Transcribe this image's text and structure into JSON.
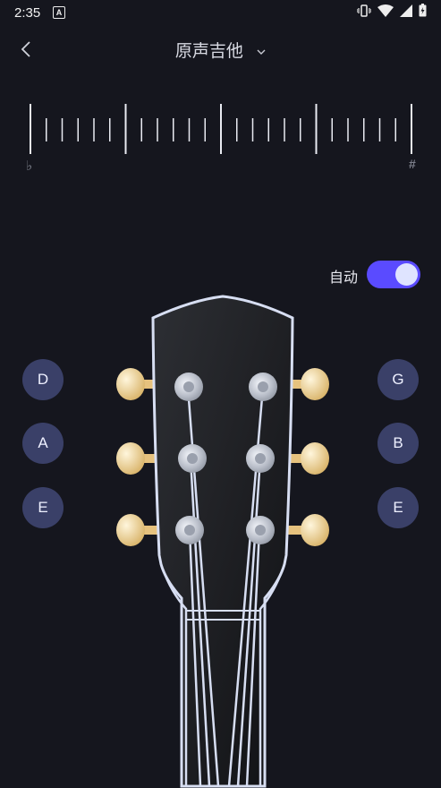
{
  "status": {
    "time": "2:35",
    "a_icon": "A"
  },
  "header": {
    "title": "原声吉他"
  },
  "scale": {
    "flat": "♭",
    "sharp": "#"
  },
  "auto": {
    "label": "自动",
    "enabled": true
  },
  "strings_left": [
    "D",
    "A",
    "E"
  ],
  "strings_right": [
    "G",
    "B",
    "E"
  ],
  "colors": {
    "background": "#15161e",
    "accent": "#5a4bff",
    "note_bg": "#3a4068",
    "peg": "#e8c784"
  }
}
